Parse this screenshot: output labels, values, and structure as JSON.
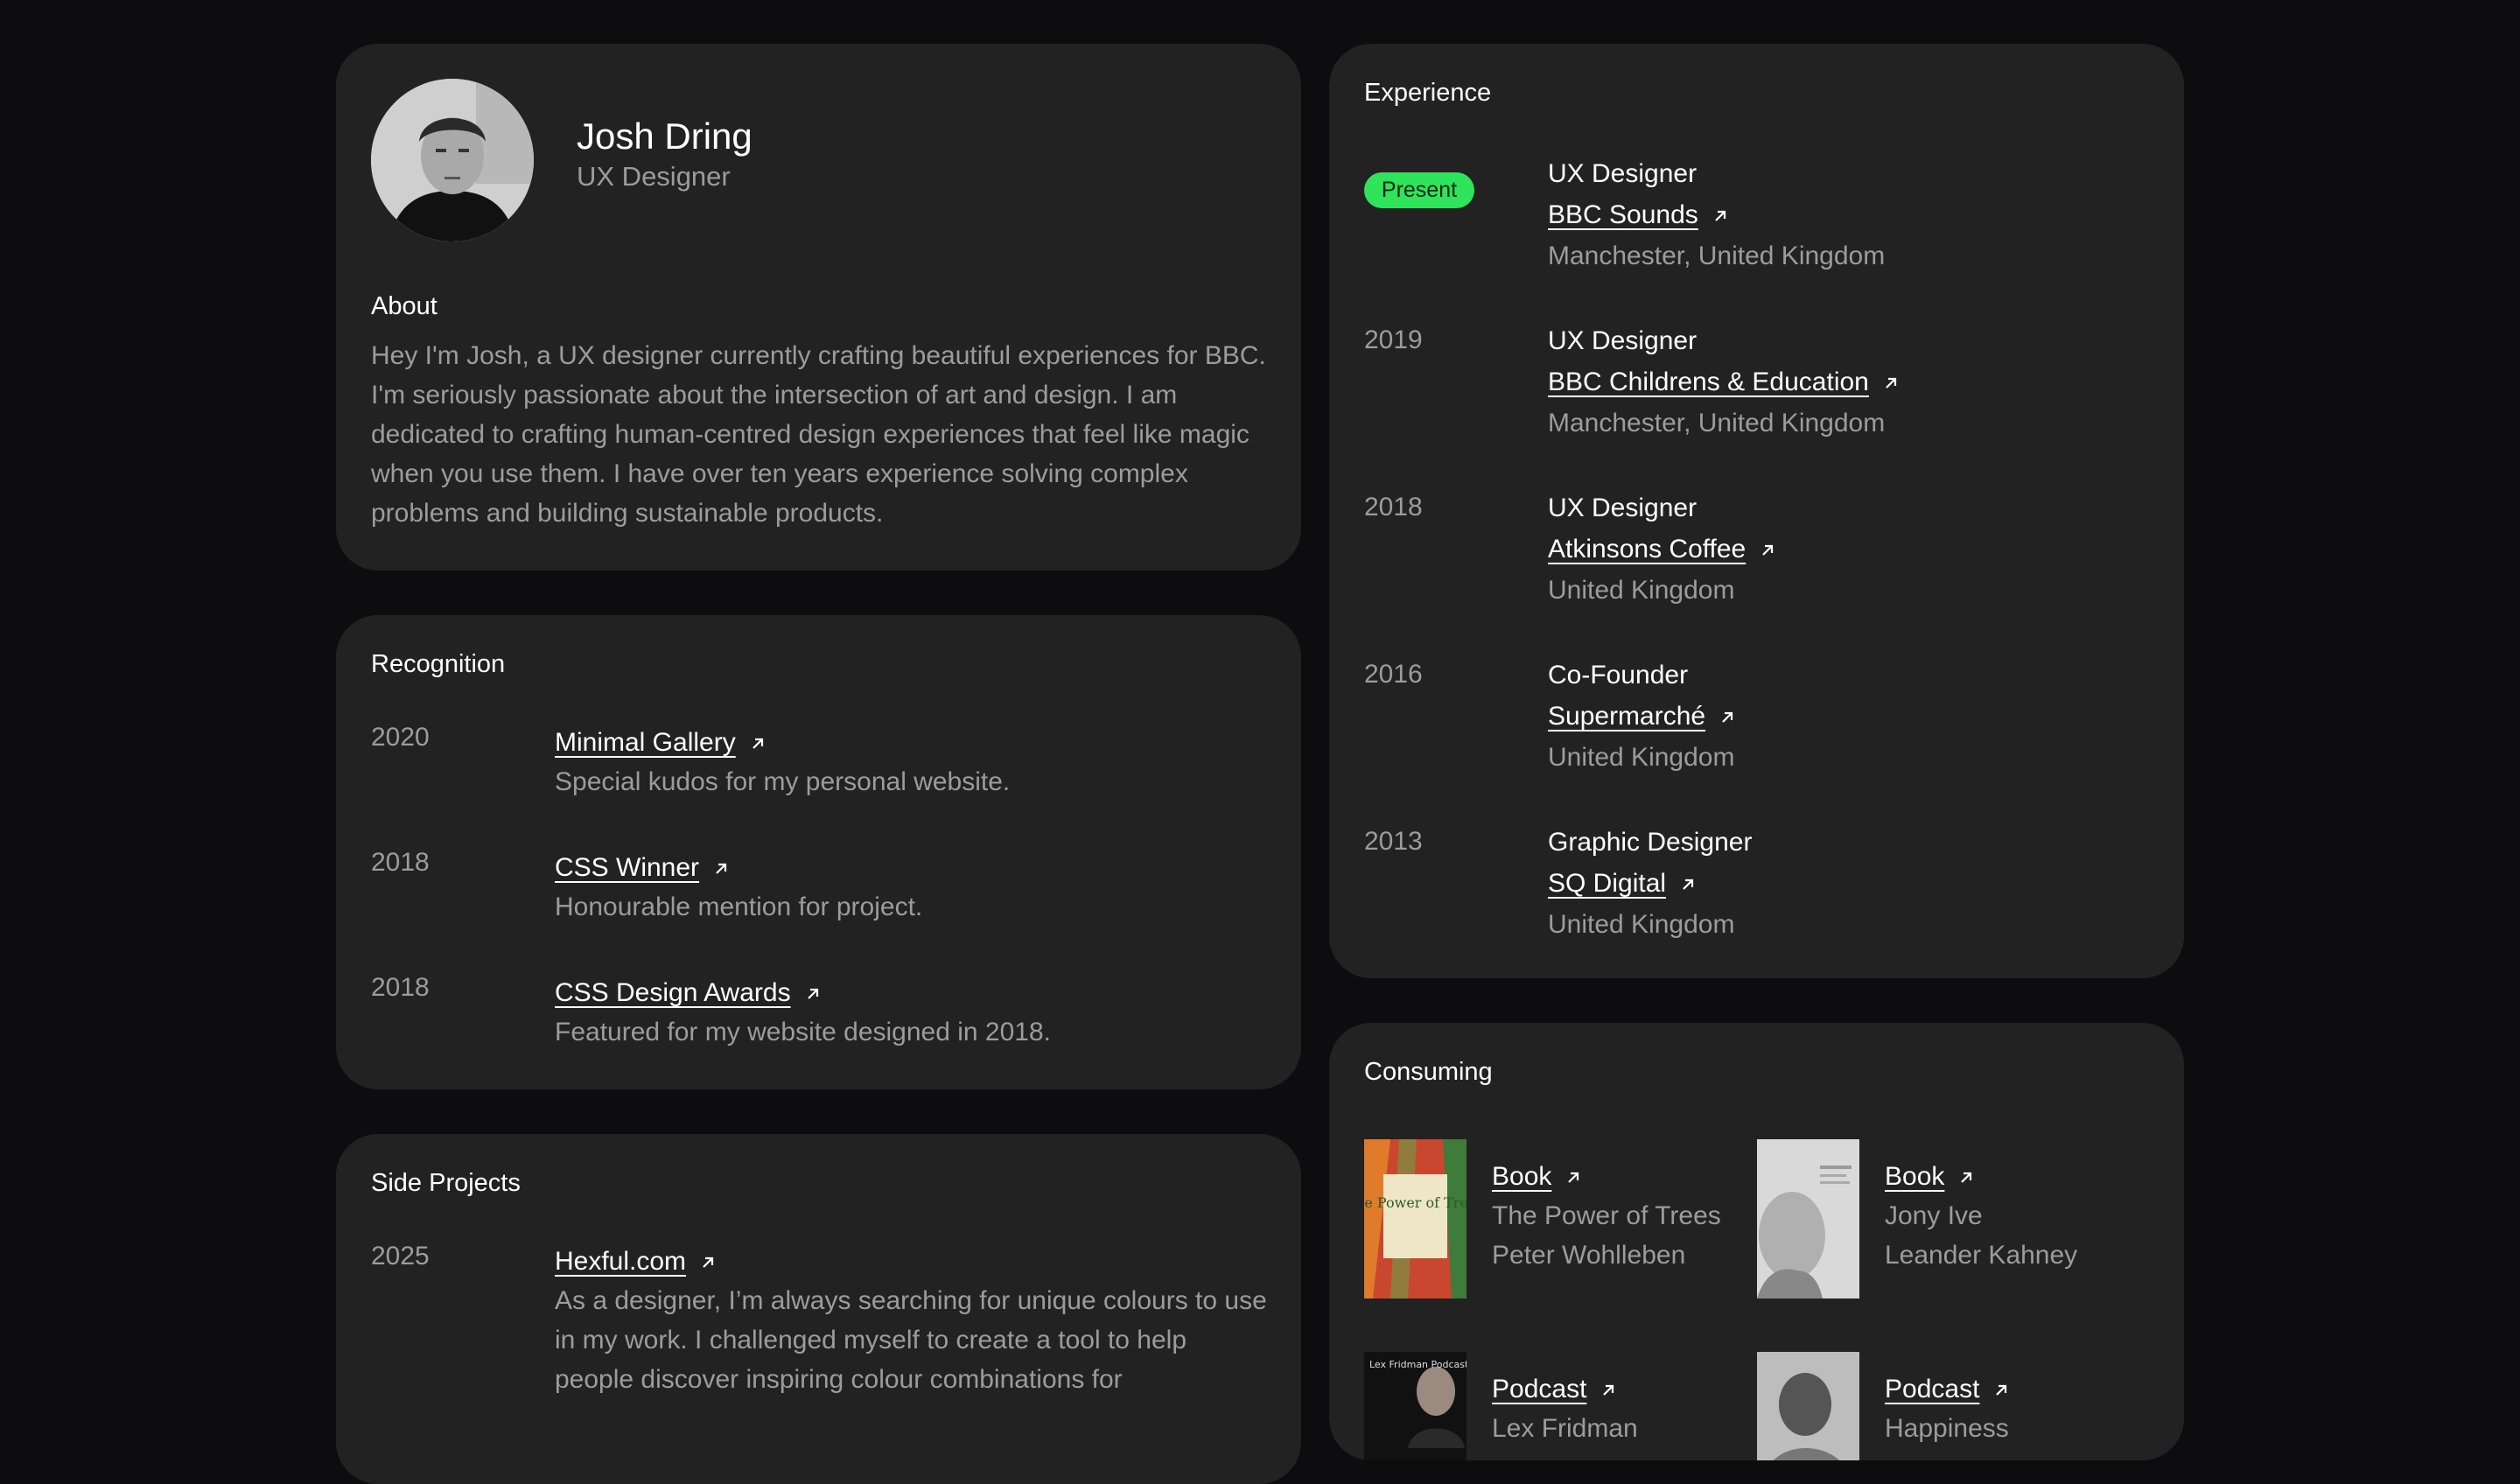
{
  "profile": {
    "name": "Josh Dring",
    "role": "UX Designer",
    "about_title": "About",
    "about_text": "Hey I'm Josh, a UX designer currently crafting beautiful experiences for BBC. I'm seriously passionate about the intersection of art and design. I am dedicated to crafting human-centred design experiences that feel like magic when you use them. I have over ten years experience solving complex problems and building sustainable products."
  },
  "recognition": {
    "title": "Recognition",
    "items": [
      {
        "year": "2020",
        "link": "Minimal Gallery",
        "desc": "Special kudos for my personal website."
      },
      {
        "year": "2018",
        "link": "CSS Winner",
        "desc": "Honourable mention for project."
      },
      {
        "year": "2018",
        "link": "CSS Design Awards",
        "desc": "Featured for my website designed in 2018."
      }
    ]
  },
  "side_projects": {
    "title": "Side Projects",
    "items": [
      {
        "year": "2025",
        "link": "Hexful.com",
        "desc": "As a designer, I’m always searching for unique colours to use in my work. I challenged myself to create a tool to help people discover inspiring colour combinations for"
      }
    ]
  },
  "experience": {
    "title": "Experience",
    "items": [
      {
        "year": "Present",
        "job": "UX Designer",
        "company": "BBC Sounds",
        "location": "Manchester, United Kingdom"
      },
      {
        "year": "2019",
        "job": "UX Designer",
        "company": "BBC Childrens & Education",
        "location": "Manchester, United Kingdom"
      },
      {
        "year": "2018",
        "job": "UX Designer",
        "company": "Atkinsons Coffee",
        "location": "United Kingdom"
      },
      {
        "year": "2016",
        "job": "Co-Founder",
        "company": "Supermarché",
        "location": "United Kingdom"
      },
      {
        "year": "2013",
        "job": "Graphic Designer",
        "company": "SQ Digital",
        "location": "United Kingdom"
      }
    ]
  },
  "consuming": {
    "title": "Consuming",
    "items": [
      {
        "type": "Book",
        "title": "The Power of Trees",
        "author": "Peter Wohlleben",
        "cover_text": "The Power of Trees"
      },
      {
        "type": "Book",
        "title": "Jony Ive",
        "author": "Leander Kahney"
      },
      {
        "type": "Podcast",
        "title": "Lex Fridman",
        "cover_text": "Lex Fridman Podcast"
      },
      {
        "type": "Podcast",
        "title": "Happiness"
      }
    ]
  },
  "colors": {
    "background": "#0d0d0f",
    "card": "#222222",
    "muted_text": "#9c9c9c",
    "present_badge": "#2fe35a"
  }
}
